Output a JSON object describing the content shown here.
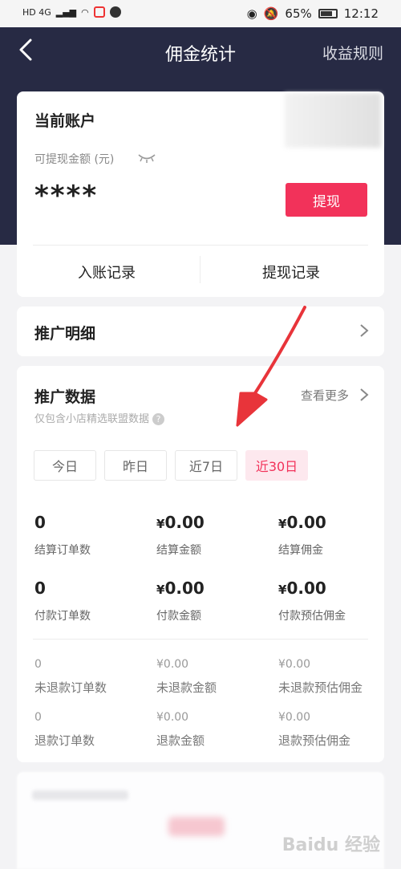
{
  "status_bar": {
    "network": "HD 4G",
    "battery": "65%",
    "time": "12:12"
  },
  "nav": {
    "title": "佣金统计",
    "right_link": "收益规则"
  },
  "account": {
    "title": "当前账户",
    "balance_label": "可提现金额 (元)",
    "balance_value": "****",
    "withdraw_button": "提现",
    "tab_income": "入账记录",
    "tab_withdraw": "提现记录"
  },
  "promo_detail": {
    "title": "推广明细"
  },
  "promo_data": {
    "title": "推广数据",
    "more": "查看更多",
    "subtitle": "仅包含小店精选联盟数据",
    "tabs": [
      "今日",
      "昨日",
      "近7日",
      "近30日"
    ],
    "active_tab": "近30日",
    "metrics": [
      {
        "value": "0",
        "label": "结算订单数"
      },
      {
        "value": "0.00",
        "currency": "¥",
        "label": "结算金额"
      },
      {
        "value": "0.00",
        "currency": "¥",
        "label": "结算佣金"
      },
      {
        "value": "0",
        "label": "付款订单数"
      },
      {
        "value": "0.00",
        "currency": "¥",
        "label": "付款金额"
      },
      {
        "value": "0.00",
        "currency": "¥",
        "label": "付款预估佣金"
      }
    ],
    "small_metrics": [
      {
        "value": "0",
        "label": "未退款订单数"
      },
      {
        "value": "¥0.00",
        "label": "未退款金额"
      },
      {
        "value": "¥0.00",
        "label": "未退款预估佣金"
      },
      {
        "value": "0",
        "label": "退款订单数"
      },
      {
        "value": "¥0.00",
        "label": "退款金额"
      },
      {
        "value": "¥0.00",
        "label": "退款预估佣金"
      }
    ]
  },
  "watermark": "Baidu 经验",
  "colors": {
    "header_bg": "#272a44",
    "accent": "#f2325a",
    "annotation_arrow": "#e8343a"
  }
}
